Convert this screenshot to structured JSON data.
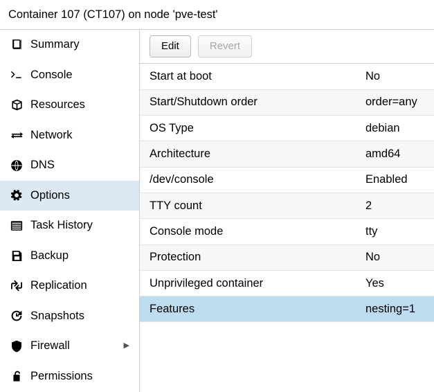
{
  "window": {
    "title": "Container 107 (CT107) on node 'pve-test'"
  },
  "sidebar": {
    "items": [
      {
        "label": "Summary",
        "icon": "book-icon",
        "selected": false,
        "submenu": false
      },
      {
        "label": "Console",
        "icon": "terminal-icon",
        "selected": false,
        "submenu": false
      },
      {
        "label": "Resources",
        "icon": "cube-icon",
        "selected": false,
        "submenu": false
      },
      {
        "label": "Network",
        "icon": "exchange-icon",
        "selected": false,
        "submenu": false
      },
      {
        "label": "DNS",
        "icon": "globe-icon",
        "selected": false,
        "submenu": false
      },
      {
        "label": "Options",
        "icon": "gear-icon",
        "selected": true,
        "submenu": false
      },
      {
        "label": "Task History",
        "icon": "list-icon",
        "selected": false,
        "submenu": false
      },
      {
        "label": "Backup",
        "icon": "floppy-icon",
        "selected": false,
        "submenu": false
      },
      {
        "label": "Replication",
        "icon": "replication-icon",
        "selected": false,
        "submenu": false
      },
      {
        "label": "Snapshots",
        "icon": "history-icon",
        "selected": false,
        "submenu": false
      },
      {
        "label": "Firewall",
        "icon": "shield-icon",
        "selected": false,
        "submenu": true
      },
      {
        "label": "Permissions",
        "icon": "unlock-icon",
        "selected": false,
        "submenu": false
      }
    ],
    "submenu_arrow": "▶"
  },
  "toolbar": {
    "edit_label": "Edit",
    "revert_label": "Revert"
  },
  "options": {
    "rows": [
      {
        "key": "Start at boot",
        "value": "No",
        "selected": false
      },
      {
        "key": "Start/Shutdown order",
        "value": "order=any",
        "selected": false
      },
      {
        "key": "OS Type",
        "value": "debian",
        "selected": false
      },
      {
        "key": "Architecture",
        "value": "amd64",
        "selected": false
      },
      {
        "key": "/dev/console",
        "value": "Enabled",
        "selected": false
      },
      {
        "key": "TTY count",
        "value": "2",
        "selected": false
      },
      {
        "key": "Console mode",
        "value": "tty",
        "selected": false
      },
      {
        "key": "Protection",
        "value": "No",
        "selected": false
      },
      {
        "key": "Unprivileged container",
        "value": "Yes",
        "selected": false
      },
      {
        "key": "Features",
        "value": "nesting=1",
        "selected": true
      }
    ]
  },
  "colors": {
    "selection": "#bedcf0",
    "nav_selection": "#dce8f3",
    "row_alt": "#f7f7f7",
    "border": "#cfcfcf"
  }
}
